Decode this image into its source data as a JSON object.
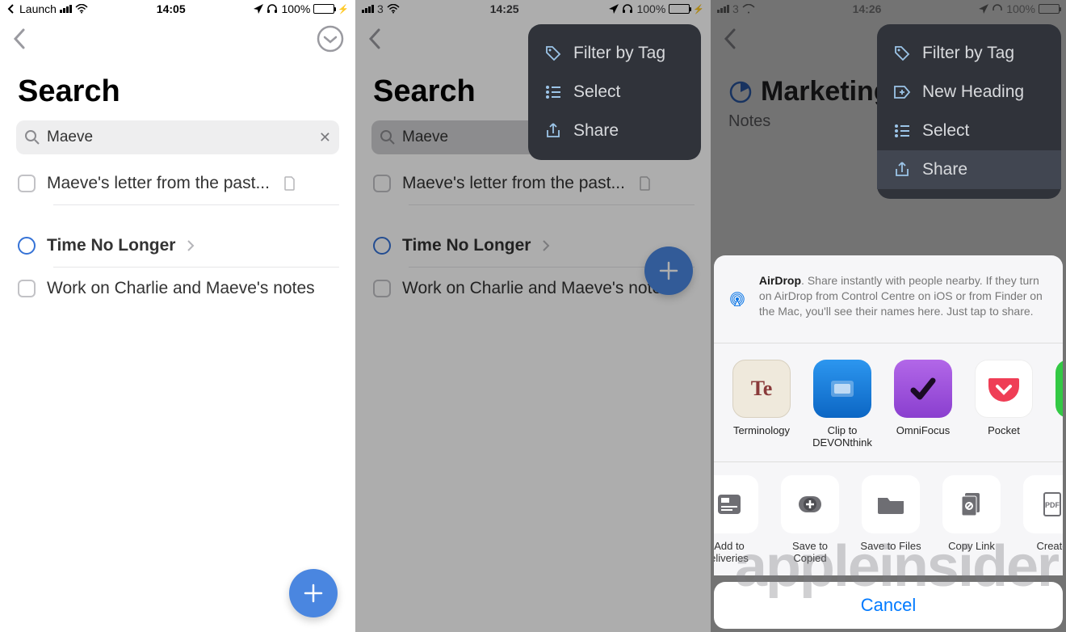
{
  "phone1": {
    "status": {
      "launch": "Launch",
      "time": "14:05",
      "batt": "100%"
    },
    "title": "Search",
    "search": {
      "value": "Maeve"
    },
    "results": [
      {
        "type": "check",
        "text": "Maeve's letter from the past...",
        "doc": true
      },
      {
        "type": "radio",
        "text": "Time No Longer",
        "bold": true,
        "chev": true
      },
      {
        "type": "check",
        "text": "Work on Charlie and Maeve's notes"
      }
    ]
  },
  "phone2": {
    "status": {
      "carrier": "3",
      "time": "14:25",
      "batt": "100%"
    },
    "title": "Search",
    "search": {
      "value": "Maeve"
    },
    "menu": [
      {
        "label": "Filter by Tag",
        "icon": "tag"
      },
      {
        "label": "Select",
        "icon": "select"
      },
      {
        "label": "Share",
        "icon": "share"
      }
    ],
    "results": [
      {
        "type": "check",
        "text": "Maeve's letter from the past...",
        "doc": true
      },
      {
        "type": "radio",
        "text": "Time No Longer",
        "bold": true,
        "chev": true
      },
      {
        "type": "check",
        "text": "Work on Charlie and Maeve's notes"
      }
    ]
  },
  "phone3": {
    "status": {
      "carrier": "3",
      "time": "14:26",
      "batt": "100%"
    },
    "header": "Marketing",
    "notes": "Notes",
    "menu": [
      {
        "label": "Filter by Tag",
        "icon": "tag"
      },
      {
        "label": "New Heading",
        "icon": "plus"
      },
      {
        "label": "Select",
        "icon": "select"
      },
      {
        "label": "Share",
        "icon": "share",
        "active": true
      }
    ],
    "airdrop": {
      "title": "AirDrop",
      "text": ". Share instantly with people nearby. If they turn on AirDrop from Control Centre on iOS or from Finder on the Mac, you'll see their names here. Just tap to share."
    },
    "apps": [
      {
        "label": "Terminology",
        "bg": "#efe9dc",
        "fg": "#8a3a3a",
        "glyph": "Te"
      },
      {
        "label": "Clip to DEVONthink",
        "bg": "#1c7bd6",
        "fg": "#fff",
        "glyph": "▭"
      },
      {
        "label": "OmniFocus",
        "bg": "#8a3fcf",
        "fg": "#000",
        "glyph": "✔"
      },
      {
        "label": "Pocket",
        "bg": "#ffffff",
        "fg": "#ef3e56",
        "glyph": "◡"
      }
    ],
    "actions": [
      {
        "label": "Add to eliveries"
      },
      {
        "label": "Save to Copied"
      },
      {
        "label": "Save to Files"
      },
      {
        "label": "Copy Link"
      },
      {
        "label": "Create"
      }
    ],
    "cancel": "Cancel"
  },
  "watermark": "appleinsider"
}
